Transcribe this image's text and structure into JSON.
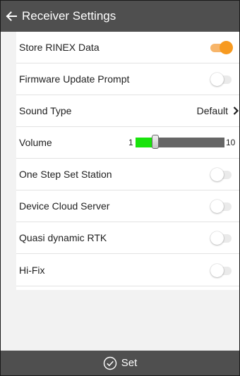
{
  "header": {
    "title": "Receiver Settings",
    "back_icon": "arrow-left-icon"
  },
  "settings": [
    {
      "label": "Store RINEX Data",
      "type": "toggle",
      "on": true
    },
    {
      "label": "Firmware Update Prompt",
      "type": "toggle",
      "on": false
    },
    {
      "label": "Sound Type",
      "type": "select",
      "value": "Default",
      "icon": "chevron-right-icon"
    },
    {
      "label": "Volume",
      "type": "slider",
      "min": "1",
      "max": "10",
      "level": 3
    },
    {
      "label": "One Step Set Station",
      "type": "toggle",
      "on": false
    },
    {
      "label": "Device Cloud Server",
      "type": "toggle",
      "on": false
    },
    {
      "label": "Quasi dynamic RTK",
      "type": "toggle",
      "on": false
    },
    {
      "label": "Hi-Fix",
      "type": "toggle",
      "on": false
    }
  ],
  "footer": {
    "set_label": "Set",
    "icon": "check-circle-icon"
  },
  "colors": {
    "header_bg": "#4f4f4f",
    "toggle_on": "#f79a20",
    "toggle_on_track": "#f7b56a",
    "slider_fill": "#19e30c",
    "slider_track": "#666666"
  }
}
